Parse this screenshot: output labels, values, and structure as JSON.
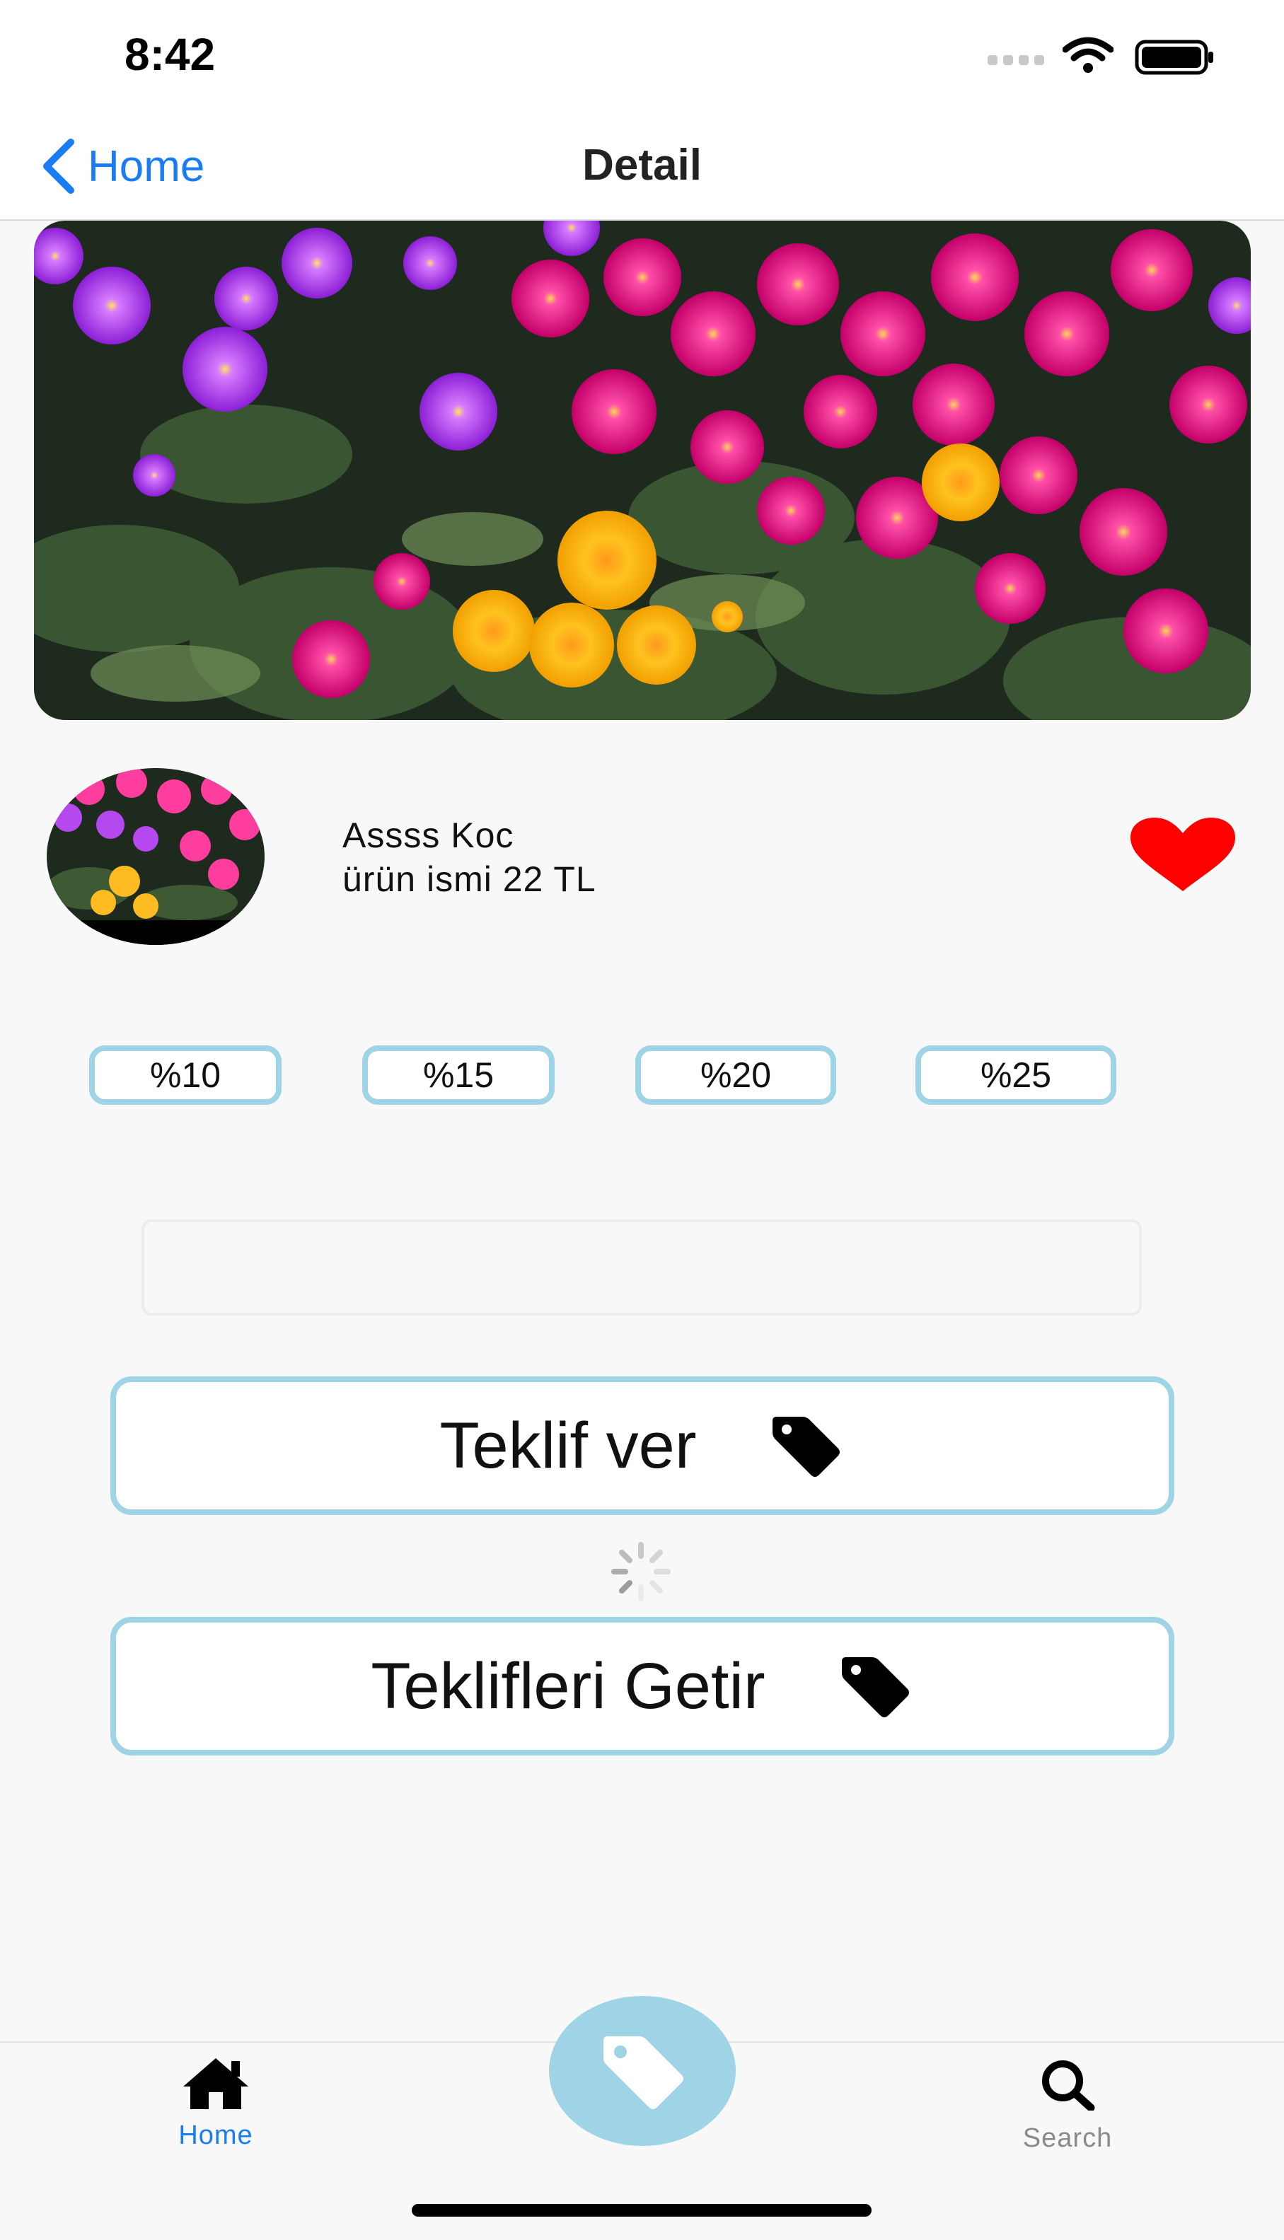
{
  "status_bar": {
    "time": "8:42"
  },
  "nav": {
    "back_label": "Home",
    "title": "Detail"
  },
  "seller": {
    "name": "Assss Koc",
    "product_line": "ürün ismi 22 TL",
    "favorited": true
  },
  "discounts": [
    "%10",
    "%15",
    "%20",
    "%25"
  ],
  "offer_input": {
    "value": "",
    "placeholder": ""
  },
  "buttons": {
    "make_offer": "Teklif ver",
    "fetch_offers": "Teklifleri Getir"
  },
  "tabs": {
    "home": "Home",
    "search": "Search",
    "active": "home"
  },
  "colors": {
    "accent_blue": "#1a7cf5",
    "pill_border": "#9fd3e6",
    "heart": "#ff0000",
    "fab": "#9fd3e6"
  },
  "icons": {
    "back": "chevron-left-icon",
    "favorite": "heart-icon",
    "tag": "tag-icon",
    "home": "house-icon",
    "search": "magnifier-icon",
    "loading": "spinner-icon"
  }
}
